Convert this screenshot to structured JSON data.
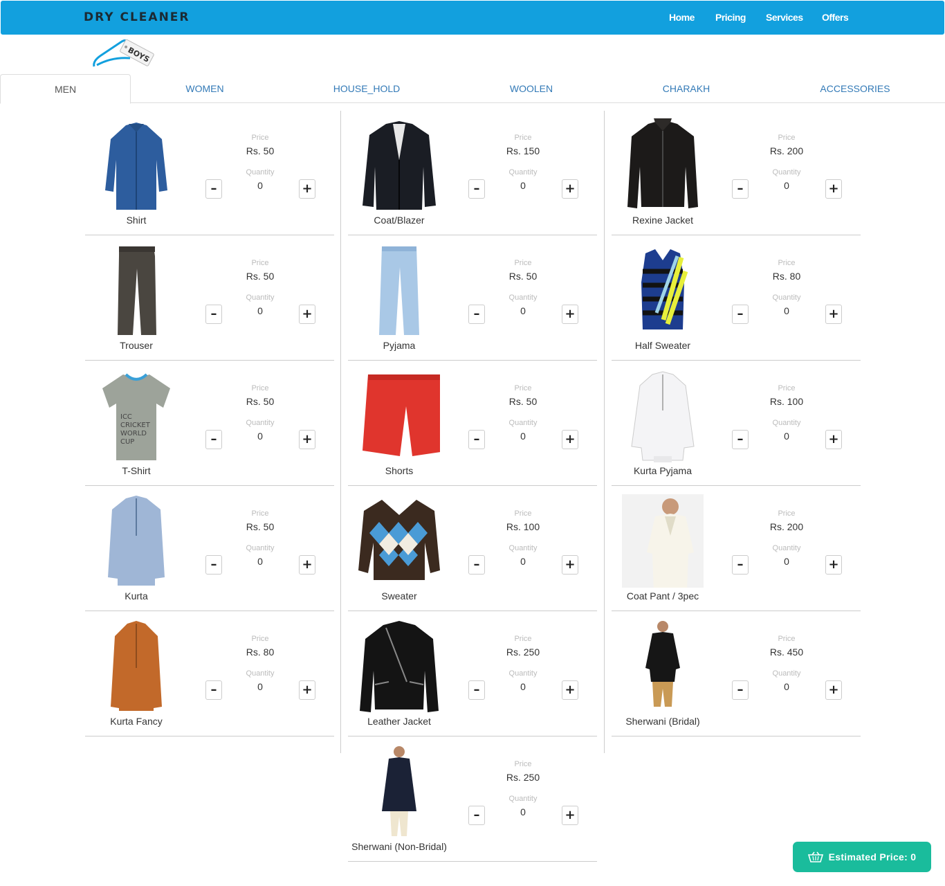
{
  "header": {
    "brand": "Dry Cleaner",
    "logo_tag": "BOYS",
    "nav": [
      "Home",
      "Pricing",
      "Services",
      "Offers"
    ]
  },
  "tabs": [
    "MEN",
    "WOMEN",
    "HOUSE_HOLD",
    "WOOLEN",
    "CHARAKH",
    "ACCESSORIES"
  ],
  "active_tab": "MEN",
  "labels": {
    "price": "Price",
    "quantity": "Quantity"
  },
  "items": [
    {
      "name": "Shirt",
      "price": "Rs. 50",
      "qty": "0"
    },
    {
      "name": "Coat/Blazer",
      "price": "Rs. 150",
      "qty": "0"
    },
    {
      "name": "Rexine Jacket",
      "price": "Rs. 200",
      "qty": "0"
    },
    {
      "name": "Trouser",
      "price": "Rs. 50",
      "qty": "0"
    },
    {
      "name": "Pyjama",
      "price": "Rs. 50",
      "qty": "0"
    },
    {
      "name": "Half Sweater",
      "price": "Rs. 80",
      "qty": "0"
    },
    {
      "name": "T-Shirt",
      "price": "Rs. 50",
      "qty": "0"
    },
    {
      "name": "Shorts",
      "price": "Rs. 50",
      "qty": "0"
    },
    {
      "name": "Kurta Pyjama",
      "price": "Rs. 100",
      "qty": "0"
    },
    {
      "name": "Kurta",
      "price": "Rs. 50",
      "qty": "0"
    },
    {
      "name": "Sweater",
      "price": "Rs. 100",
      "qty": "0"
    },
    {
      "name": "Coat Pant / 3pec",
      "price": "Rs. 200",
      "qty": "0"
    },
    {
      "name": "Kurta Fancy",
      "price": "Rs. 80",
      "qty": "0"
    },
    {
      "name": "Leather Jacket",
      "price": "Rs. 250",
      "qty": "0"
    },
    {
      "name": "Sherwani (Bridal)",
      "price": "Rs. 450",
      "qty": "0"
    },
    {
      "name": "Sherwani (Non-Bridal)",
      "price": "Rs. 250",
      "qty": "0"
    }
  ],
  "estimate_label": "Estimated Price: 0",
  "colors": {
    "header": "#12a0de",
    "link": "#337ab7",
    "estimate": "#1abc9c"
  }
}
